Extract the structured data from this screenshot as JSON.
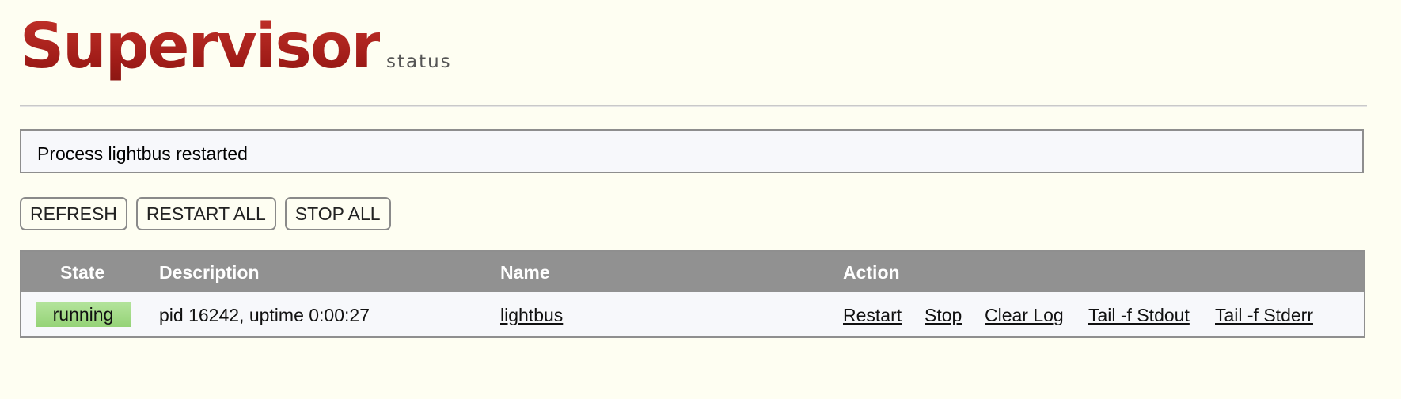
{
  "header": {
    "logo_title": "Supervisor",
    "logo_subtitle": "status"
  },
  "message": "Process lightbus restarted",
  "buttons": {
    "refresh": "REFRESH",
    "restart_all": "RESTART ALL",
    "stop_all": "STOP ALL"
  },
  "table": {
    "headers": {
      "state": "State",
      "description": "Description",
      "name": "Name",
      "action": "Action"
    },
    "rows": [
      {
        "state": "running",
        "state_color": "#a6dd8b",
        "description": "pid 16242, uptime 0:00:27",
        "name": "lightbus",
        "actions": {
          "restart": "Restart",
          "stop": "Stop",
          "clear_log": "Clear Log",
          "tail_stdout": "Tail -f Stdout",
          "tail_stderr": "Tail -f Stderr"
        }
      }
    ]
  },
  "colors": {
    "brand": "#a9231e",
    "page_background": "#fefef2",
    "table_header": "#919191",
    "running": "#a6dd8b"
  }
}
